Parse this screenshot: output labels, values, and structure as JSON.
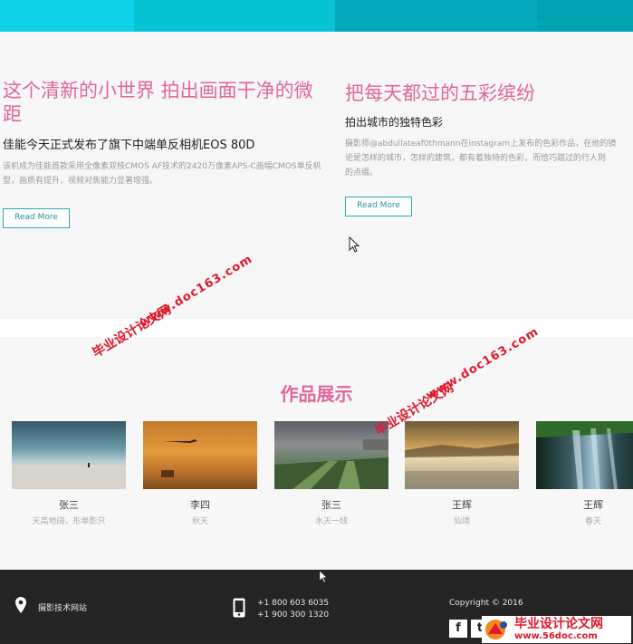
{
  "colors": {
    "accent_pink": "#e0679a",
    "accent_teal": "#2aa7b8",
    "footer_bg": "#252525",
    "topbar": [
      "#0fd3e8",
      "#08c3d6",
      "#03a9ba",
      "#00a1b0"
    ]
  },
  "news": {
    "left": {
      "title": "这个清新的小世界 拍出画面干净的微距",
      "subtitle": "佳能今天正式发布了旗下中端单反相机EOS 80D",
      "description": "该机成为佳能首款采用全像素双核CMOS AF技术的2420万像素APS-C画幅CMOS单反机型，画质有提升，视频对焦能力显著增强。",
      "button": "Read More"
    },
    "right": {
      "title": "把每天都过的五彩缤纷",
      "subtitle": "拍出城市的独特色彩",
      "description_line1": "摄影师@abdullateaf0thmann在instagram上发布的色彩作品，在他的镜",
      "description_line2": "论是怎样的城市，怎样的建筑，都有着独特的色彩，而恰巧踏过的行人则",
      "description_line3": "的点缀。",
      "button": "Read More"
    }
  },
  "gallery": {
    "title": "作品展示",
    "items": [
      {
        "name": "张三",
        "caption": "天高地阔，形单影只"
      },
      {
        "name": "李四",
        "caption": "秋天"
      },
      {
        "name": "张三",
        "caption": "水天一线"
      },
      {
        "name": "王辉",
        "caption": "仙境"
      },
      {
        "name": "王辉",
        "caption": "春天"
      }
    ]
  },
  "footer": {
    "site": "摄影技术网站",
    "phone1": "+1 800 603 6035",
    "phone2": "+1 900 300 1320",
    "copyright": "Copyright © 2016",
    "icons": [
      "location-pin-icon",
      "mobile-phone-icon",
      "facebook-icon",
      "twitter-icon"
    ],
    "social": {
      "facebook": "f",
      "twitter": "t"
    }
  },
  "watermarks": {
    "school": "毕业设计论文网",
    "url": "www.doc163.com",
    "logo_main": "毕业设计论文网",
    "logo_url": "www.56doc.com"
  }
}
